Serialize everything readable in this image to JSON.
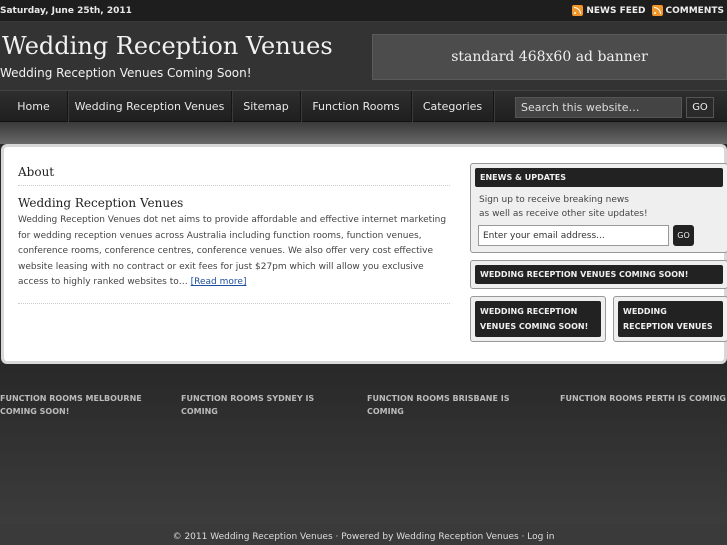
{
  "topbar": {
    "date": "Saturday, June 25th, 2011",
    "news_feed": "NEWS FEED",
    "comments": "COMMENTS"
  },
  "header": {
    "title": "Wedding Reception Venues",
    "description": "Wedding Reception Venues Coming Soon!",
    "ad_banner": "standard 468x60 ad banner"
  },
  "nav": {
    "items": [
      "Home",
      "Wedding Reception Venues",
      "Sitemap",
      "Function Rooms",
      "Categories"
    ],
    "search_placeholder": "Search this website…",
    "search_button": "GO"
  },
  "content": {
    "section_title": "About",
    "post_title": "Wedding Reception Venues",
    "post_body": "Wedding Reception Venues dot net aims to provide affordable and effective internet marketing for wedding reception venues across Australia including function rooms, function venues, conference rooms, conference centres, conference venues. We also offer very cost effective website leasing with no contract or exit fees for just $27pm which will allow you exclusive access to highly ranked websites to… ",
    "read_more": "[Read more]"
  },
  "sidebar": {
    "enews_title": "ENEWS & UPDATES",
    "enews_line1": "Sign up to receive breaking news",
    "enews_line2": "as well as receive other site updates!",
    "email_placeholder": "Enter your email address...",
    "email_button": "GO",
    "widget2_title": "WEDDING RECEPTION VENUES COMING SOON!",
    "widget3_title_line1": "WEDDING RECEPTION",
    "widget3_title_line2": "VENUES COMING SOON!",
    "widget4_title_line1": "WEDDING",
    "widget4_title_line2": "RECEPTION VENUES"
  },
  "footer_widgets": [
    {
      "line1": "FUNCTION ROOMS MELBOURNE",
      "line2": "COMING SOON!"
    },
    {
      "line1": "FUNCTION ROOMS SYDNEY IS",
      "line2": "COMING"
    },
    {
      "line1": "FUNCTION ROOMS BRISBANE IS",
      "line2": "COMING"
    },
    {
      "line1": "FUNCTION ROOMS PERTH IS COMING",
      "line2": ""
    }
  ],
  "footer": {
    "text": "© 2011 Wedding Reception Venues · Powered by Wedding Reception Venues · Log in"
  }
}
